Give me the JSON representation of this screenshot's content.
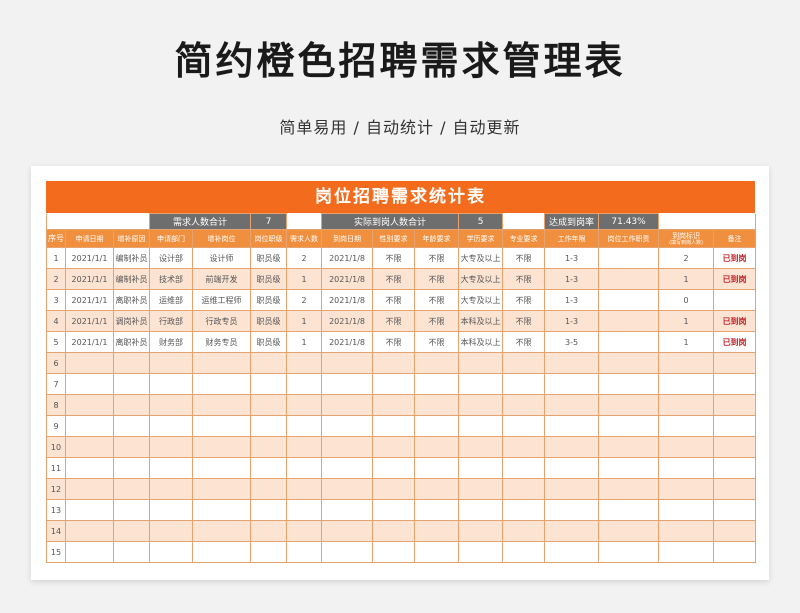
{
  "page": {
    "title": "简约橙色招聘需求管理表",
    "subtitle": "简单易用  /  自动统计  /  自动更新"
  },
  "sheet": {
    "banner": "岗位招聘需求统计表",
    "summary": {
      "need_label": "需求人数合计",
      "need_value": "7",
      "actual_label": "实际到岗人数合计",
      "actual_value": "5",
      "rate_label": "达成到岗率",
      "rate_value": "71.43%"
    },
    "headers": [
      "序号",
      "申请日期",
      "增补原因",
      "申请部门",
      "增补岗位",
      "岗位职级",
      "需求人数",
      "到岗日期",
      "性别要求",
      "年龄要求",
      "学历要求",
      "专业要求",
      "工作年限",
      "岗位工作职责",
      "到岗标识",
      "备注"
    ],
    "header_note": "(填写到岗人数)",
    "rows": [
      {
        "seq": "1",
        "date": "2021/1/1",
        "reason": "编制补员",
        "dept": "设计部",
        "pos": "设计师",
        "level": "职员级",
        "need": "2",
        "arrive": "2021/1/8",
        "gender": "不限",
        "age": "不限",
        "edu": "大专及以上",
        "major": "不限",
        "years": "1-3",
        "duty": "",
        "flag": "2",
        "note": "已到岗"
      },
      {
        "seq": "2",
        "date": "2021/1/1",
        "reason": "编制补员",
        "dept": "技术部",
        "pos": "前端开发",
        "level": "职员级",
        "need": "1",
        "arrive": "2021/1/8",
        "gender": "不限",
        "age": "不限",
        "edu": "大专及以上",
        "major": "不限",
        "years": "1-3",
        "duty": "",
        "flag": "1",
        "note": "已到岗"
      },
      {
        "seq": "3",
        "date": "2021/1/1",
        "reason": "离职补员",
        "dept": "运维部",
        "pos": "运维工程师",
        "level": "职员级",
        "need": "2",
        "arrive": "2021/1/8",
        "gender": "不限",
        "age": "不限",
        "edu": "大专及以上",
        "major": "不限",
        "years": "1-3",
        "duty": "",
        "flag": "0",
        "note": ""
      },
      {
        "seq": "4",
        "date": "2021/1/1",
        "reason": "调岗补员",
        "dept": "行政部",
        "pos": "行政专员",
        "level": "职员级",
        "need": "1",
        "arrive": "2021/1/8",
        "gender": "不限",
        "age": "不限",
        "edu": "本科及以上",
        "major": "不限",
        "years": "1-3",
        "duty": "",
        "flag": "1",
        "note": "已到岗"
      },
      {
        "seq": "5",
        "date": "2021/1/1",
        "reason": "离职补员",
        "dept": "财务部",
        "pos": "财务专员",
        "level": "职员级",
        "need": "1",
        "arrive": "2021/1/8",
        "gender": "不限",
        "age": "不限",
        "edu": "本科及以上",
        "major": "不限",
        "years": "3-5",
        "duty": "",
        "flag": "1",
        "note": "已到岗"
      },
      {
        "seq": "6"
      },
      {
        "seq": "7"
      },
      {
        "seq": "8"
      },
      {
        "seq": "9"
      },
      {
        "seq": "10"
      },
      {
        "seq": "11"
      },
      {
        "seq": "12"
      },
      {
        "seq": "13"
      },
      {
        "seq": "14"
      },
      {
        "seq": "15"
      }
    ]
  }
}
